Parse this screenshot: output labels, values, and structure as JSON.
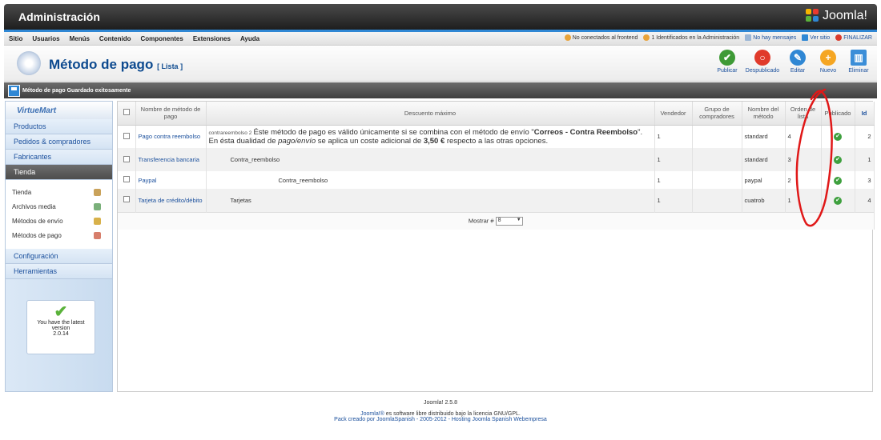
{
  "header": {
    "title": "Administración",
    "brand": "Joomla!"
  },
  "menu": [
    "Sitio",
    "Usuarios",
    "Menús",
    "Contenido",
    "Componentes",
    "Extensiones",
    "Ayuda"
  ],
  "status": {
    "frontend": "No conectados al frontend",
    "admin": "1 Identificados en la Administración",
    "messages": "No hay mensajes",
    "view_site": "Ver sitio",
    "logout": "FINALIZAR"
  },
  "page": {
    "title": "Método de pago",
    "subtitle": "[ Lista ]"
  },
  "toolbar": {
    "publish": "Publicar",
    "unpublish": "Despublicado",
    "edit": "Editar",
    "new": "Nuevo",
    "delete": "Eliminar"
  },
  "message": "Método de pago Guardado exitosamente",
  "sidebar": {
    "logo": "VirtueMart",
    "items": [
      "Productos",
      "Pedidos & compradores",
      "Fabricantes",
      "Tienda"
    ],
    "subitems": [
      "Tienda",
      "Archivos media",
      "Métodos de envío",
      "Métodos de pago"
    ],
    "bottom_items": [
      "Configuración",
      "Herramientas"
    ],
    "latest": {
      "line1": "You have the latest",
      "line2": "version",
      "version": "2.0.14"
    }
  },
  "table": {
    "headers": {
      "name": "Nombre de método de pago",
      "discount": "Descuento máximo",
      "vendor": "Vendedor",
      "group": "Grupo de compradores",
      "method": "Nombre del método",
      "order": "Orden de lista",
      "published": "Publicado",
      "id": "Id"
    },
    "rows": [
      {
        "name": "Pago contra reembolso",
        "code": "contrareembolso 2",
        "desc_a": "Éste método de pago es válido únicamente si se combina con el método de envío \"",
        "desc_b": "Correos - Contra Reembolso",
        "desc_c": "\". En ésta dualidad de ",
        "desc_d": "pago/envío",
        "desc_e": " se aplica un coste adicional de ",
        "desc_f": "3,50 €",
        "desc_g": " respecto a las otras opciones.",
        "vendor": "1",
        "method": "standard",
        "order": "4",
        "id": "2"
      },
      {
        "name": "Transferencia bancaria",
        "code": "Contra_reembolso",
        "vendor": "1",
        "method": "standard",
        "order": "3",
        "id": "1"
      },
      {
        "name": "Paypal",
        "code": "Contra_reembolso",
        "vendor": "1",
        "method": "paypal",
        "order": "2",
        "id": "3"
      },
      {
        "name": "Tarjeta de crédito/débito",
        "code": "Tarjetas",
        "vendor": "1",
        "method": "cuatrob",
        "order": "1",
        "id": "4"
      }
    ],
    "show_label": "Mostrar #",
    "show_value": "8"
  },
  "footer": {
    "version": "Joomla! 2.5.8",
    "license_link": "Joomla!®",
    "license_rest": " es software libre distribuido bajo la licencia GNU/GPL.",
    "credits": "Pack creado por JoomlaSpanish - 2005-2012 - Hosting Joomla Spanish Webempresa"
  }
}
